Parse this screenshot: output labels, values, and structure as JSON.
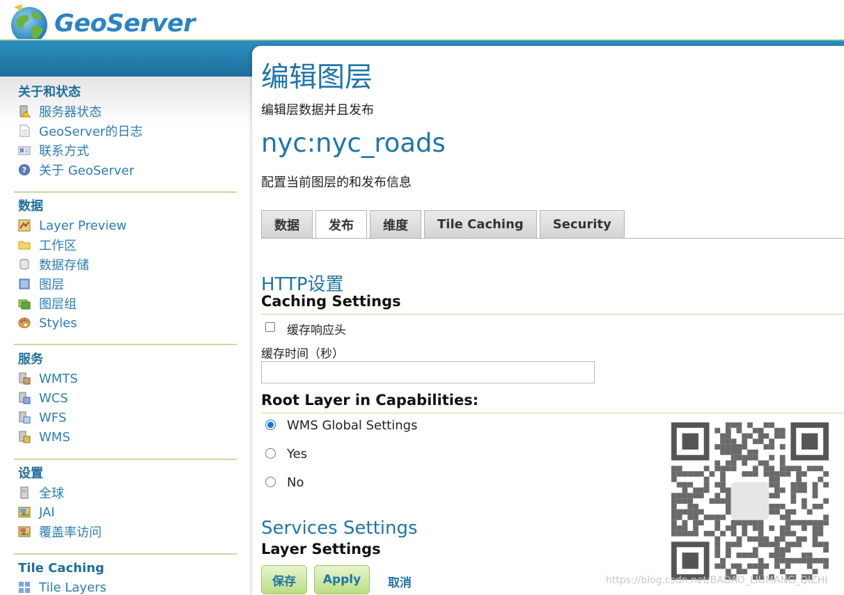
{
  "header": {
    "logo_text": "GeoServer"
  },
  "sidebar": {
    "sections": [
      {
        "title": "关于和状态",
        "items": [
          {
            "label": "服务器状态",
            "icon": "server-status-icon"
          },
          {
            "label": "GeoServer的日志",
            "icon": "log-document-icon"
          },
          {
            "label": "联系方式",
            "icon": "contact-card-icon"
          },
          {
            "label": "关于 GeoServer",
            "icon": "help-icon"
          }
        ]
      },
      {
        "title": "数据",
        "items": [
          {
            "label": "Layer Preview",
            "icon": "map-preview-icon"
          },
          {
            "label": "工作区",
            "icon": "folder-icon"
          },
          {
            "label": "数据存储",
            "icon": "database-icon"
          },
          {
            "label": "图层",
            "icon": "layer-icon"
          },
          {
            "label": "图层组",
            "icon": "layer-group-icon"
          },
          {
            "label": "Styles",
            "icon": "palette-icon"
          }
        ]
      },
      {
        "title": "服务",
        "items": [
          {
            "label": "WMTS",
            "icon": "wmts-service-icon"
          },
          {
            "label": "WCS",
            "icon": "wcs-service-icon"
          },
          {
            "label": "WFS",
            "icon": "wfs-service-icon"
          },
          {
            "label": "WMS",
            "icon": "wms-service-icon"
          }
        ]
      },
      {
        "title": "设置",
        "items": [
          {
            "label": "全球",
            "icon": "global-server-icon"
          },
          {
            "label": "JAI",
            "icon": "jai-image-icon"
          },
          {
            "label": "覆盖率访问",
            "icon": "coverage-access-icon"
          }
        ]
      },
      {
        "title": "Tile Caching",
        "items": [
          {
            "label": "Tile Layers",
            "icon": "tile-layers-icon"
          }
        ]
      }
    ]
  },
  "main": {
    "title": "编辑图层",
    "description": "编辑层数据并且发布",
    "layer_name": "nyc:nyc_roads",
    "layer_description": "配置当前图层的和发布信息",
    "tabs": [
      "数据",
      "发布",
      "维度",
      "Tile Caching",
      "Security"
    ],
    "active_tab": "发布",
    "http": {
      "heading": "HTTP设置",
      "subheading": "Caching Settings",
      "cache_headers_label": "缓存响应头",
      "cache_headers_checked": false,
      "cache_time_label": "缓存时间（秒）",
      "cache_time_value": ""
    },
    "root_layer": {
      "heading": "Root Layer in Capabilities:",
      "options": [
        "WMS Global Settings",
        "Yes",
        "No"
      ],
      "selected": "WMS Global Settings"
    },
    "services": {
      "heading": "Services Settings",
      "subheading": "Layer Settings"
    },
    "actions": {
      "save": "保存",
      "apply": "Apply",
      "cancel": "取消"
    }
  },
  "overlay": {
    "watermark": "https://blog.csdn.net/BADAO_LIUMANG_QIZHI"
  },
  "colors": {
    "accent": "#1e75a8",
    "header_band": "#1b6f9b",
    "button_green": "#b9de84",
    "divider_green": "#c5d9a0"
  }
}
